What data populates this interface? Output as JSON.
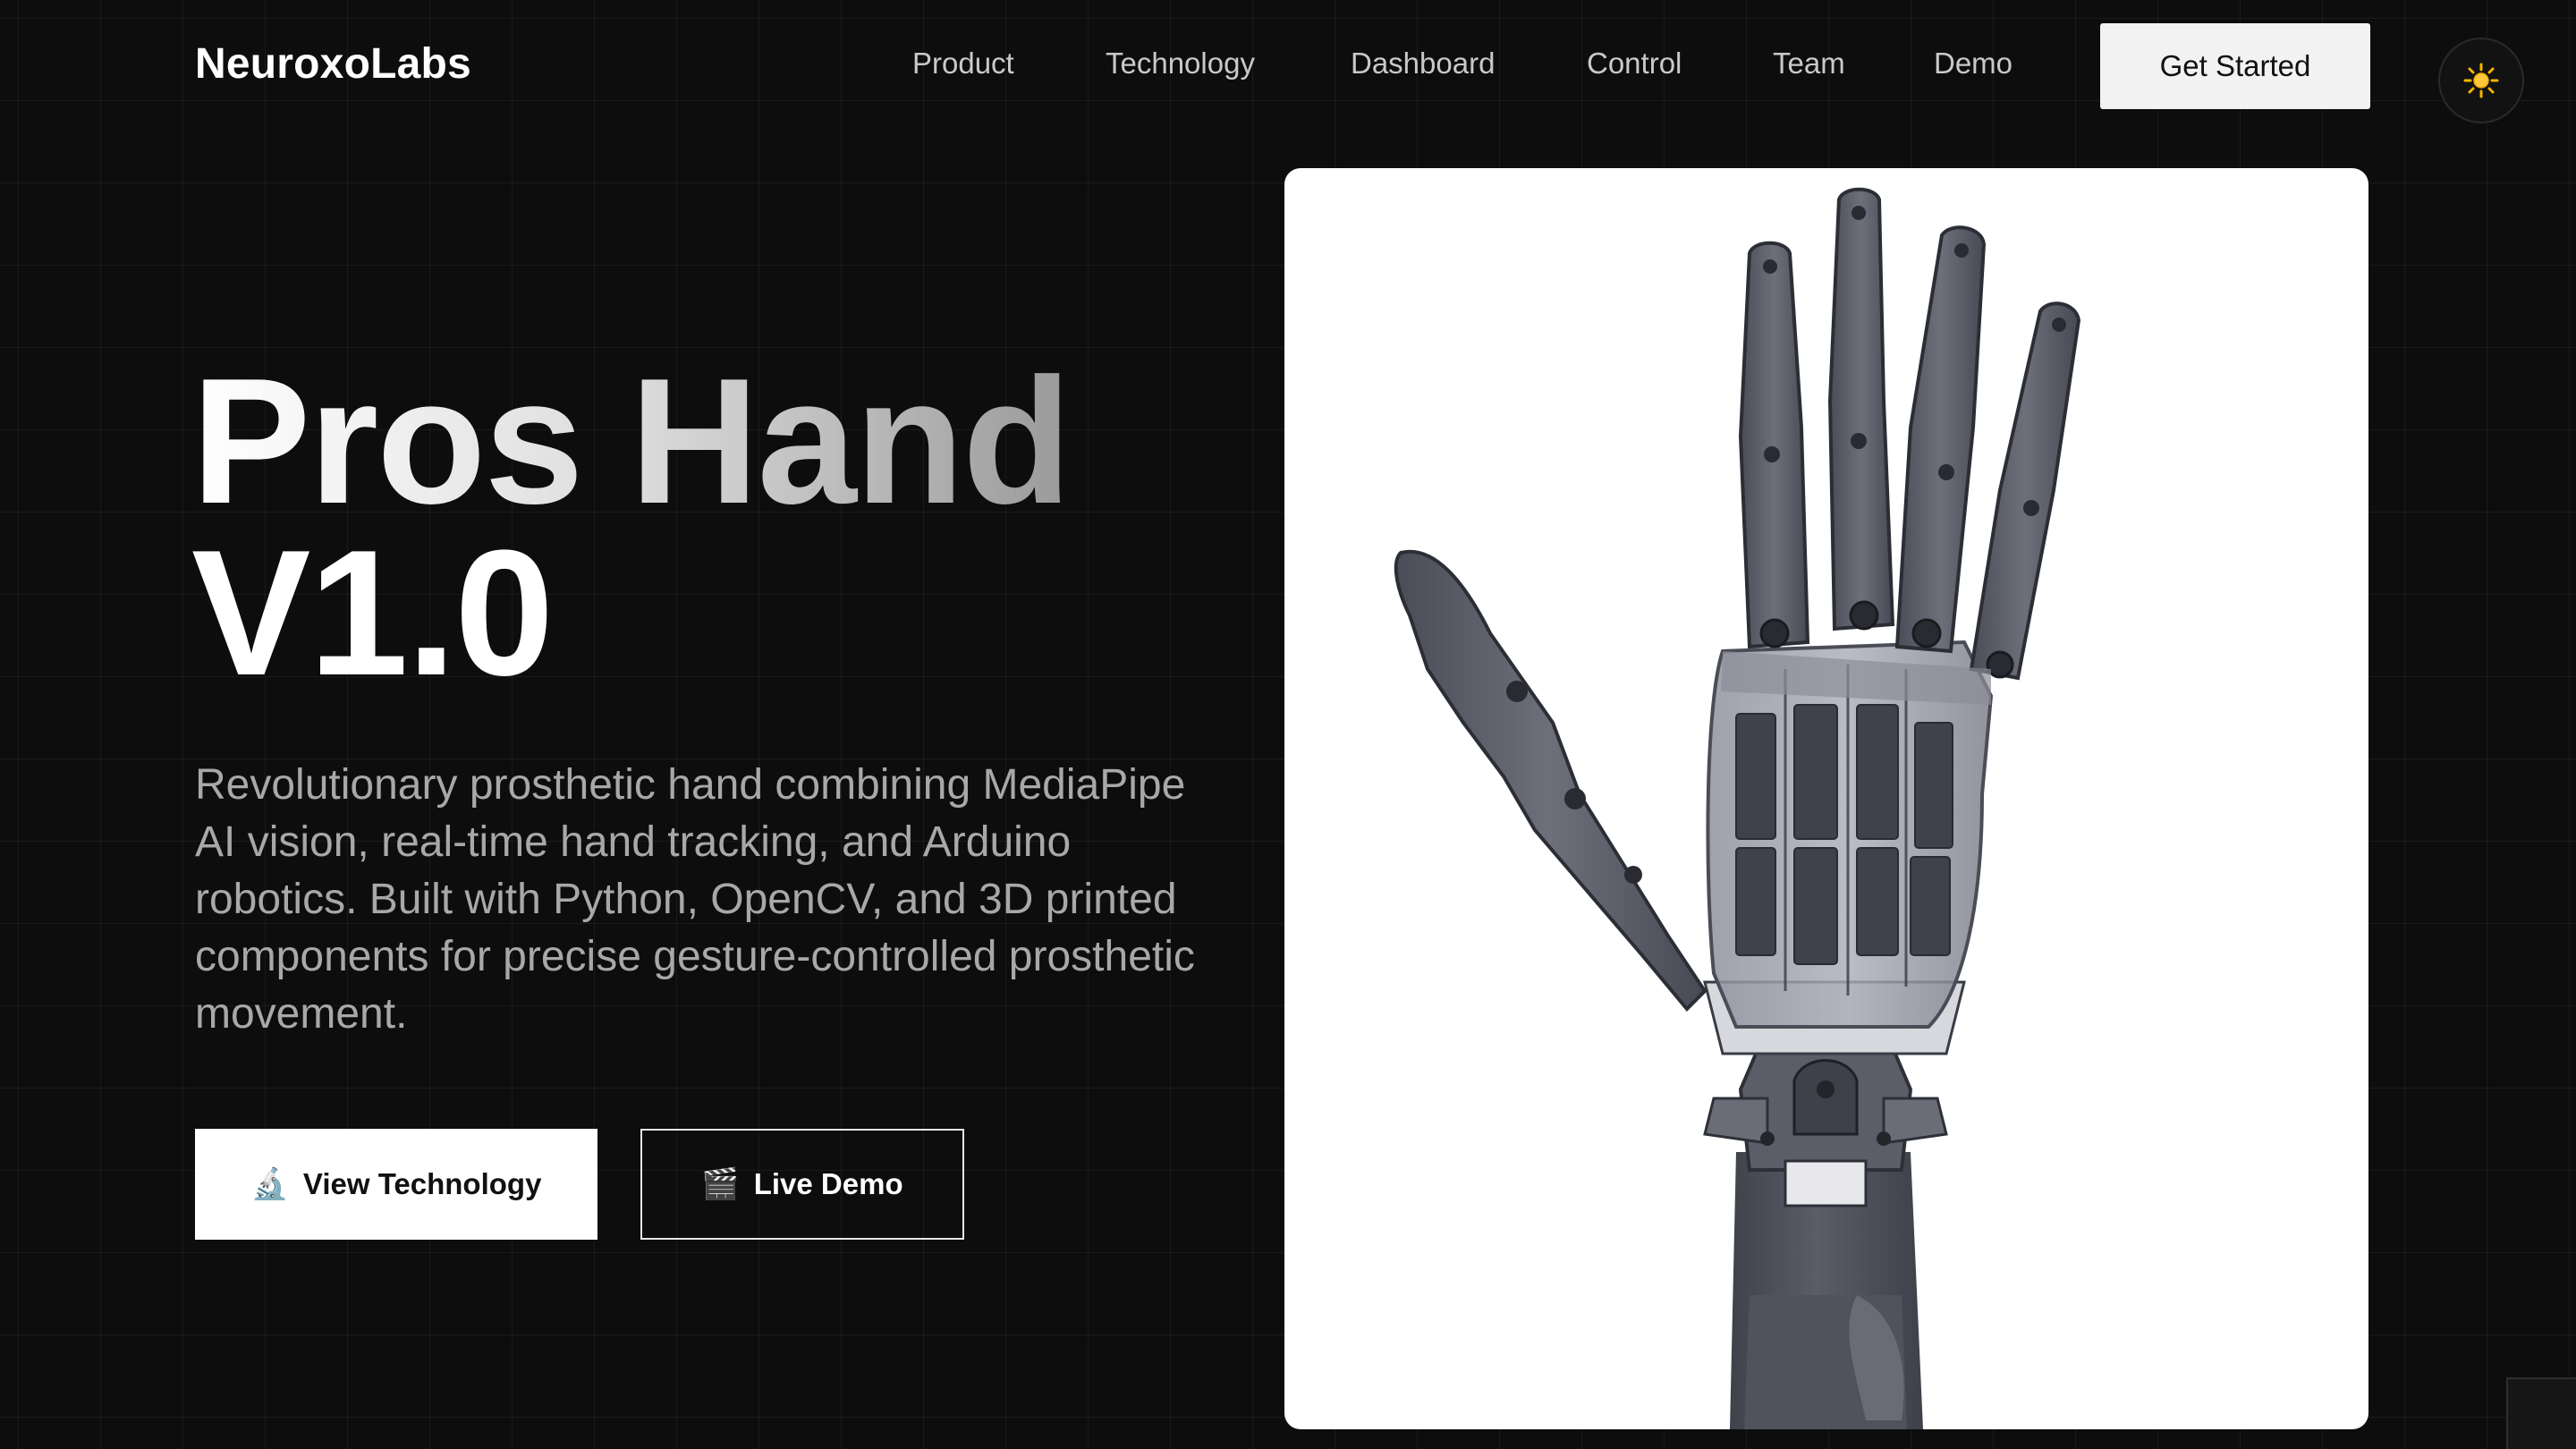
{
  "brand": {
    "name": "NeuroxoLabs"
  },
  "nav": {
    "links": [
      "Product",
      "Technology",
      "Dashboard",
      "Control",
      "Team",
      "Demo"
    ],
    "cta_label": "Get Started",
    "theme_icon": "sun-icon"
  },
  "hero": {
    "title_line1": "Pros Hand",
    "title_line2": "V1.0",
    "description": "Revolutionary prosthetic hand combining MediaPipe AI vision, real-time hand tracking, and Arduino robotics. Built with Python, OpenCV, and 3D printed components for precise gesture-controlled prosthetic movement.",
    "primary_button": {
      "icon": "🔬",
      "label": "View Technology"
    },
    "secondary_button": {
      "icon": "🎬",
      "label": "Live Demo"
    }
  },
  "colors": {
    "background": "#0d0d0d",
    "text_primary": "#ffffff",
    "text_muted": "#a8a8a8",
    "cta_background": "#f2f2f2",
    "card_background": "#ffffff"
  }
}
